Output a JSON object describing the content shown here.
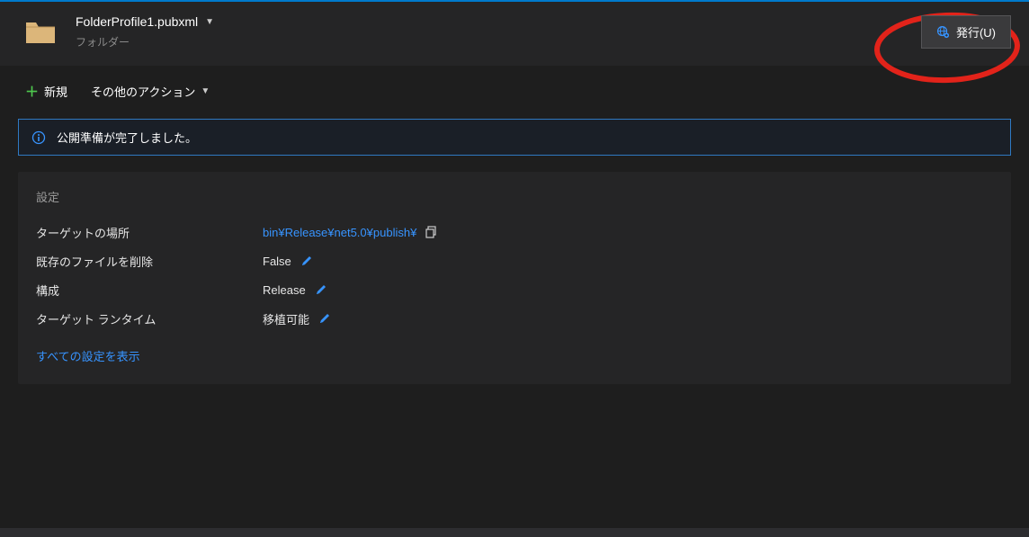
{
  "header": {
    "profile_name": "FolderProfile1.pubxml",
    "profile_type": "フォルダー",
    "publish_button": "発行(U)"
  },
  "actions": {
    "new_label": "新規",
    "more_label": "その他のアクション"
  },
  "status": {
    "message": "公開準備が完了しました。"
  },
  "settings": {
    "title": "設定",
    "rows": [
      {
        "label": "ターゲットの場所",
        "value": "bin¥Release¥net5.0¥publish¥",
        "is_link": true,
        "has_copy": true,
        "has_edit": false
      },
      {
        "label": "既存のファイルを削除",
        "value": "False",
        "is_link": false,
        "has_copy": false,
        "has_edit": true
      },
      {
        "label": "構成",
        "value": "Release",
        "is_link": false,
        "has_copy": false,
        "has_edit": true
      },
      {
        "label": "ターゲット ランタイム",
        "value": "移植可能",
        "is_link": false,
        "has_copy": false,
        "has_edit": true
      }
    ],
    "show_all": "すべての設定を表示"
  }
}
